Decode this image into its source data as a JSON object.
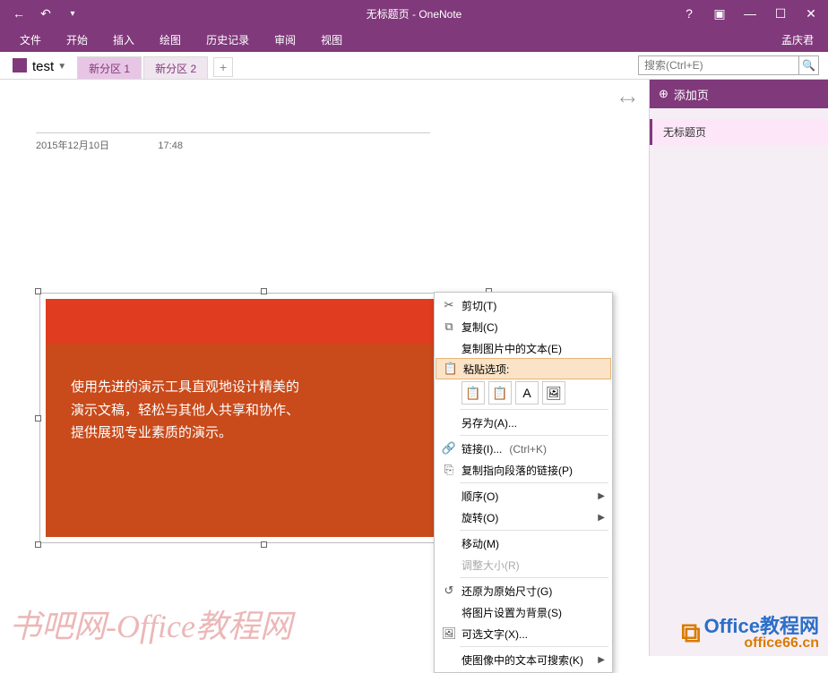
{
  "window": {
    "title": "无标题页 - OneNote",
    "user": "孟庆君"
  },
  "menu": {
    "items": [
      "文件",
      "开始",
      "插入",
      "绘图",
      "历史记录",
      "审阅",
      "视图"
    ]
  },
  "notebook": {
    "name": "test",
    "tabs": [
      {
        "label": "新分区 1",
        "active": false
      },
      {
        "label": "新分区 2",
        "active": true
      }
    ],
    "search_placeholder": "搜索(Ctrl+E)"
  },
  "sidepanel": {
    "add_page": "添加页",
    "pages": [
      "无标题页"
    ]
  },
  "page": {
    "date": "2015年12月10日",
    "time": "17:48"
  },
  "slide": {
    "line1": "使用先进的演示工具直观地设计精美的",
    "line2": "演示文稿，轻松与其他人共享和协作、",
    "line3": "提供展现专业素质的演示。"
  },
  "contextmenu": {
    "cut": "剪切(T)",
    "copy": "复制(C)",
    "copy_text": "复制图片中的文本(E)",
    "paste_options": "粘贴选项:",
    "save_as": "另存为(A)...",
    "link": "链接(I)...",
    "link_shortcut": "(Ctrl+K)",
    "copy_link": "复制指向段落的链接(P)",
    "order": "顺序(O)",
    "rotate": "旋转(O)",
    "move": "移动(M)",
    "resize": "调整大小(R)",
    "restore": "还原为原始尺寸(G)",
    "set_bg": "将图片设置为背景(S)",
    "alt_text": "可选文字(X)...",
    "searchable": "使图像中的文本可搜索(K)"
  },
  "watermark": {
    "left": "书吧网-Office教程网",
    "top": "Office教程网",
    "bottom": "office66.cn"
  }
}
